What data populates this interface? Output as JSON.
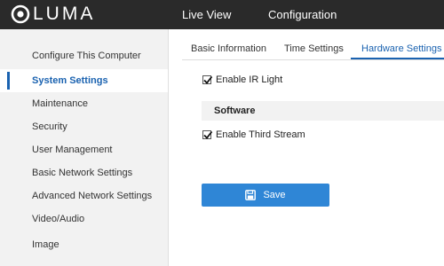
{
  "header": {
    "logo_text": "LUMA",
    "nav": [
      "Live View",
      "Configuration"
    ]
  },
  "sidebar": {
    "items": [
      {
        "label": "Configure This Computer",
        "active": false
      },
      {
        "label": "System Settings",
        "active": true
      },
      {
        "label": "Maintenance",
        "active": false
      },
      {
        "label": "Security",
        "active": false
      },
      {
        "label": "User Management",
        "active": false
      },
      {
        "label": "Basic Network Settings",
        "active": false
      },
      {
        "label": "Advanced Network Settings",
        "active": false
      },
      {
        "label": "Video/Audio",
        "active": false
      },
      {
        "label": "Image",
        "active": false
      }
    ]
  },
  "tabs": [
    {
      "label": "Basic Information",
      "active": false
    },
    {
      "label": "Time Settings",
      "active": false
    },
    {
      "label": "Hardware Settings",
      "active": true
    }
  ],
  "content": {
    "enable_ir_light": {
      "label": "Enable IR Light",
      "checked": true
    },
    "software_section": "Software",
    "enable_third_stream": {
      "label": "Enable Third Stream",
      "checked": true
    },
    "save_label": "Save"
  },
  "colors": {
    "accent": "#1a62b0",
    "button": "#2f86d6",
    "topbar": "#2a2a2a"
  },
  "icons": [
    "luma-logo-icon",
    "check-icon",
    "save-icon"
  ]
}
